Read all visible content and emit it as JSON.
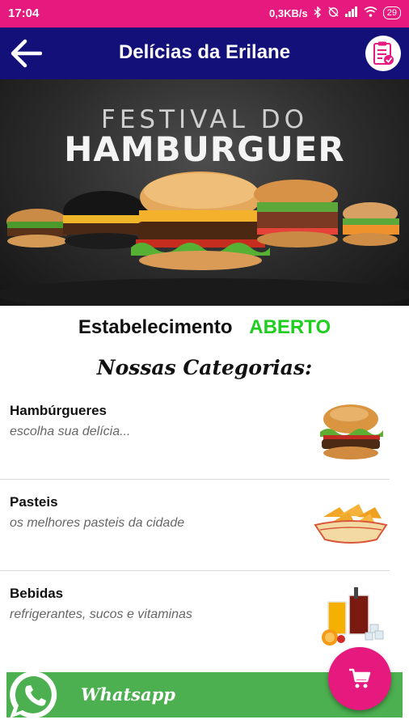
{
  "status_bar": {
    "time": "17:04",
    "network_speed": "0,3KB/s",
    "battery": "29"
  },
  "app_bar": {
    "title": "Delícias da Erilane",
    "back_icon": "arrow-left-icon",
    "orders_icon": "clipboard-check-icon"
  },
  "banner": {
    "line1": "FESTIVAL DO",
    "line2": "HAMBURGUER"
  },
  "establishment": {
    "label": "Estabelecimento",
    "status": "ABERTO",
    "status_color": "#1fce1f"
  },
  "categories_heading": "Nossas Categorias:",
  "categories": [
    {
      "name": "Hambúrgueres",
      "description": "escolha sua delícia...",
      "image": "hamburger-image"
    },
    {
      "name": "Pasteis",
      "description": "os melhores pasteis da cidade",
      "image": "pastel-basket-image"
    },
    {
      "name": "Bebidas",
      "description": "refrigerantes, sucos e vitaminas",
      "image": "drinks-image"
    }
  ],
  "whatsapp": {
    "label": "Whatsapp",
    "icon": "whatsapp-icon",
    "color": "#4caf50"
  },
  "cart_fab": {
    "icon": "shopping-cart-icon",
    "color": "#e6197e"
  },
  "colors": {
    "status_bar": "#e6197e",
    "app_bar": "#13107a"
  }
}
